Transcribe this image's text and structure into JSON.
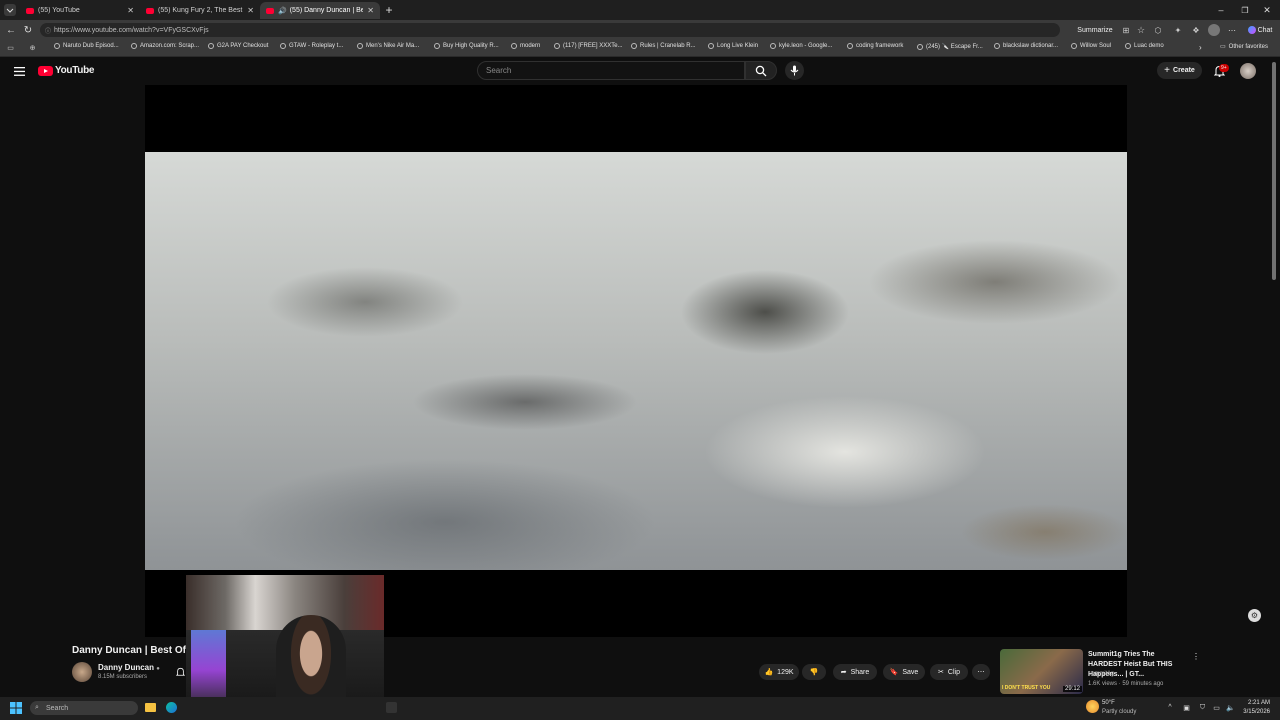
{
  "browser": {
    "tabs": [
      {
        "label": "(55) YouTube",
        "active": false
      },
      {
        "label": "(55) Kung Fury 2, The Best 10 Min...",
        "active": false
      },
      {
        "label": "(55) Danny Duncan | Best Of...",
        "active": true
      }
    ],
    "url": "https://www.youtube.com/watch?v=VFyGSCXvFjs",
    "summarize_label": "Summarize",
    "chat_label": "Chat",
    "bookmarks": [
      "Naruto Dub Episod...",
      "Amazon.com: Scrap...",
      "G2A PAY Checkout",
      "GTAW - Roleplay t...",
      "Men's Nike Air Ma...",
      "Buy High Quality R...",
      "modern",
      "(117) [FREE] XXXTe...",
      "Rules | Cranelab R...",
      "Long Live Klein",
      "kyle.leon - Google...",
      "coding framework",
      "(245) 🔪 Escape Fr...",
      "blackslaw dictionar...",
      "Willow Soul",
      "Luac demo"
    ],
    "other_favorites": "Other favorites"
  },
  "youtube": {
    "logo_text": "YouTube",
    "search_placeholder": "Search",
    "create_label": "Create",
    "notification_count": "9+"
  },
  "video": {
    "title": "Danny Duncan | Best Of 2023",
    "channel": "Danny Duncan",
    "subscribers": "8.15M subscribers",
    "likes": "129K",
    "share_label": "Share",
    "save_label": "Save",
    "clip_label": "Clip"
  },
  "recommendation": {
    "title": "Summit1g Tries The HARDEST Heist But THIS Happens... | GT...",
    "channel": "summit1g",
    "meta": "1.6K views · 59 minutes ago",
    "duration": "29:12",
    "thumb_text": "I DON'T TRUST YOU"
  },
  "taskbar": {
    "search_placeholder": "Search",
    "weather_temp": "50°F",
    "weather_desc": "Partly cloudy",
    "time": "2:21 AM",
    "date": "3/15/2026"
  },
  "colors": {
    "accent": "#ff0033",
    "background": "#0f0f0f"
  }
}
